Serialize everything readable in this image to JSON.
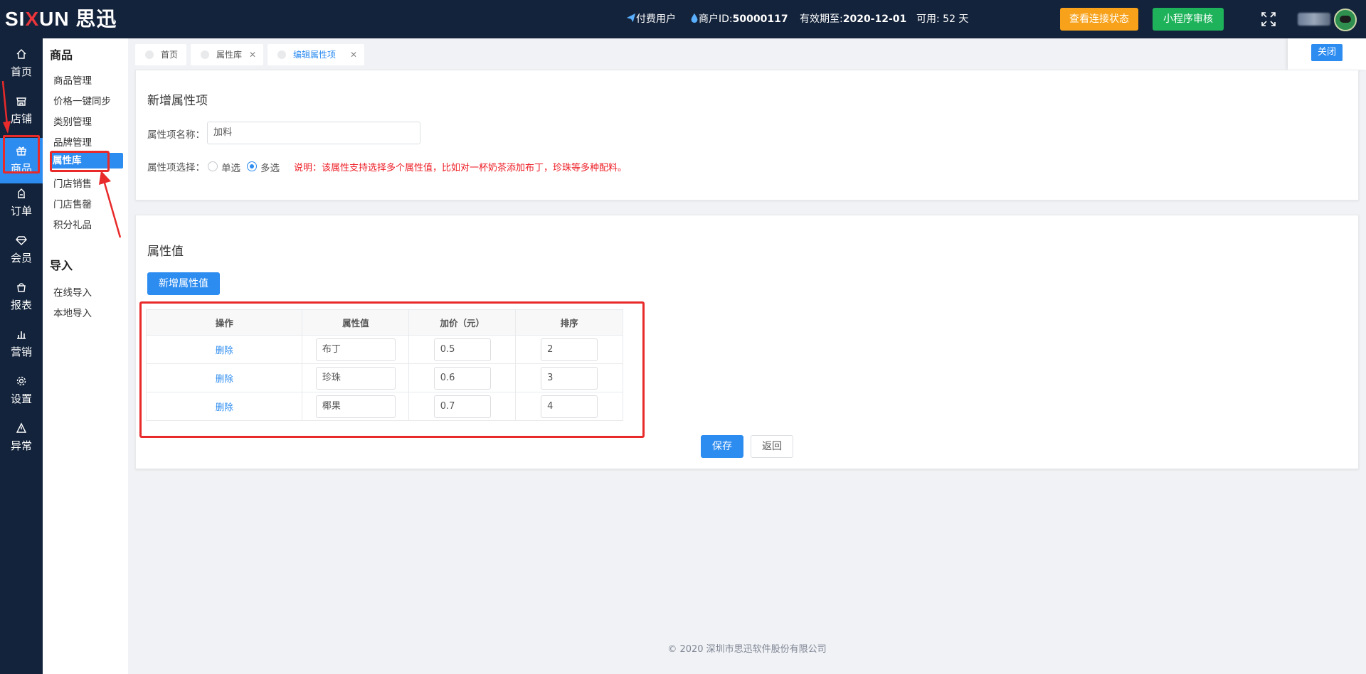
{
  "header": {
    "logo_text": "SIXUN",
    "logo_cn": "思迅",
    "user_type": "付费用户",
    "merchant_label": "商户ID:",
    "merchant_id": "50000117",
    "expiry_label": "有效期至:",
    "expiry_date": "2020-12-01",
    "available_label": "可用: ",
    "available_days": "52 天",
    "check_status_btn": "查看连接状态",
    "miniapp_review_btn": "小程序审核"
  },
  "sidenav": {
    "items": [
      {
        "label": "首页",
        "icon": "home-icon"
      },
      {
        "label": "店铺",
        "icon": "store-icon"
      },
      {
        "label": "商品",
        "icon": "gift-icon"
      },
      {
        "label": "订单",
        "icon": "order-icon"
      },
      {
        "label": "会员",
        "icon": "diamond-icon"
      },
      {
        "label": "报表",
        "icon": "bag-icon"
      },
      {
        "label": "营销",
        "icon": "bar-chart-icon"
      },
      {
        "label": "设置",
        "icon": "gear-icon"
      },
      {
        "label": "异常",
        "icon": "warning-icon"
      }
    ]
  },
  "subnav": {
    "section1_title": "商品",
    "section1_items": [
      "商品管理",
      "价格一键同步",
      "类别管理",
      "品牌管理",
      "属性库",
      "门店销售",
      "门店售罄",
      "积分礼品"
    ],
    "section2_title": "导入",
    "section2_items": [
      "在线导入",
      "本地导入"
    ]
  },
  "tabs": [
    {
      "label": "首页",
      "closable": false
    },
    {
      "label": "属性库",
      "closable": true
    },
    {
      "label": "编辑属性项",
      "closable": true
    }
  ],
  "close_label": "关闭",
  "form": {
    "title": "新增属性项",
    "name_label": "属性项名称：",
    "name_value": "加料",
    "select_label": "属性项选择：",
    "option_single": "单选",
    "option_multi": "多选",
    "selected": "多选",
    "note": "说明：该属性支持选择多个属性值，比如对一杯奶茶添加布丁，珍珠等多种配料。"
  },
  "values_section": {
    "title": "属性值",
    "add_button": "新增属性值",
    "columns": [
      "操作",
      "属性值",
      "加价（元）",
      "排序"
    ],
    "rows": [
      {
        "action": "删除",
        "value": "布丁",
        "price": "0.5",
        "order": "2"
      },
      {
        "action": "删除",
        "value": "珍珠",
        "price": "0.6",
        "order": "3"
      },
      {
        "action": "删除",
        "value": "椰果",
        "price": "0.7",
        "order": "4"
      }
    ],
    "save_button": "保存",
    "back_button": "返回"
  },
  "footer": "© 2020 深圳市思迅软件股份有限公司",
  "colors": {
    "nav_bg": "#13233b",
    "primary": "#2d8cf0",
    "orange": "#f7a21a",
    "green": "#1eb35a",
    "annotation_red": "#e82a2a"
  }
}
